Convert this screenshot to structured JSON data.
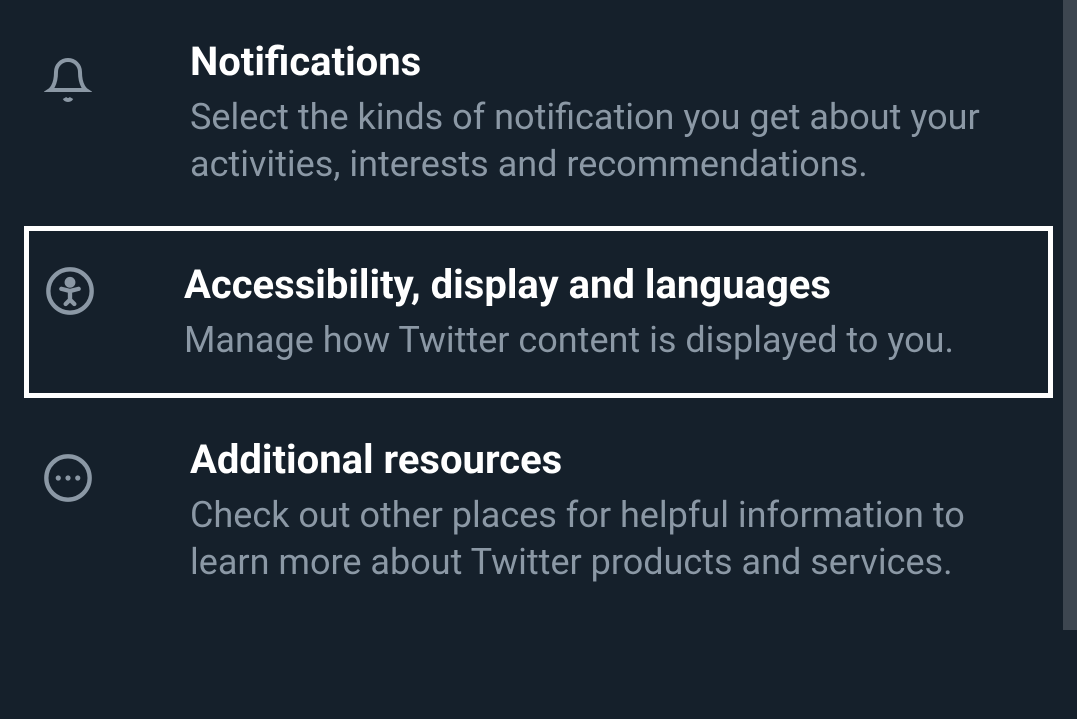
{
  "settings": {
    "items": [
      {
        "icon": "bell",
        "title": "Notifications",
        "description": "Select the kinds of notification you get about your activities, interests and recommendations.",
        "highlighted": false
      },
      {
        "icon": "accessibility",
        "title": "Accessibility, display and languages",
        "description": "Manage how Twitter content is displayed to you.",
        "highlighted": true
      },
      {
        "icon": "more",
        "title": "Additional resources",
        "description": "Check out other places for helpful information to learn more about Twitter products and services.",
        "highlighted": false
      }
    ]
  }
}
